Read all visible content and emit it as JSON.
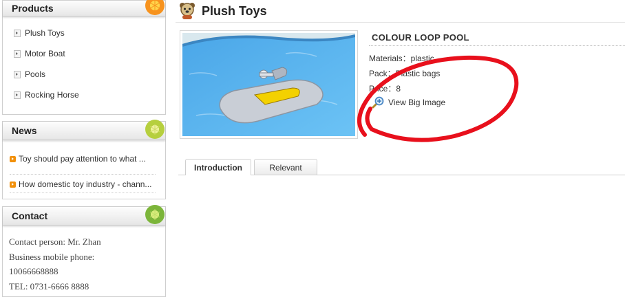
{
  "sidebar": {
    "products": {
      "title": "Products",
      "items": [
        {
          "label": "Plush Toys"
        },
        {
          "label": "Motor Boat"
        },
        {
          "label": "Pools"
        },
        {
          "label": "Rocking Horse"
        }
      ]
    },
    "news": {
      "title": "News",
      "items": [
        {
          "label": "Toy should pay attention to what ..."
        },
        {
          "label": "How domestic toy industry - chann..."
        }
      ]
    },
    "contact": {
      "title": "Contact",
      "lines": [
        "Contact person: Mr. Zhan",
        "Business mobile phone:",
        "10066668888",
        "TEL: 0731-6666 8888"
      ]
    }
  },
  "main": {
    "page_title": "Plush Toys",
    "product": {
      "name": "COLOUR LOOP POOL",
      "materials": "Materials：plastic",
      "pack": "Pack：Plastic bags",
      "price": "Price：8",
      "view_big_image": "View Big Image"
    },
    "tabs": [
      {
        "label": "Introduction",
        "active": true
      },
      {
        "label": "Relevant",
        "active": false
      }
    ]
  },
  "colors": {
    "annotation_red": "#e8101c",
    "orange_icon": "#f7931e",
    "lime_icon": "#b6cf3e",
    "news_bullet": "#f2900a"
  },
  "icons": [
    "orange-slice-icon",
    "lime-slice-icon",
    "bear-icon",
    "magnifier-icon",
    "arrow-bullet-icon"
  ]
}
